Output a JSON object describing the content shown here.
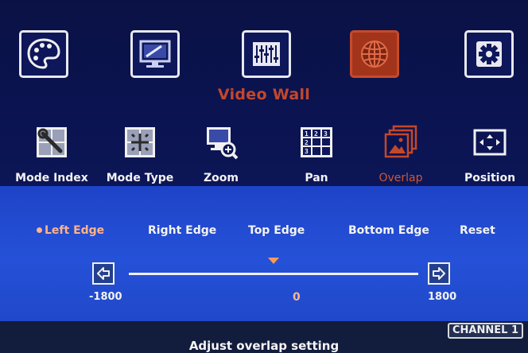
{
  "main_menu": {
    "items": [
      {
        "icon": "palette-icon",
        "active": false
      },
      {
        "icon": "monitor-settings-icon",
        "active": false
      },
      {
        "icon": "equalizer-icon",
        "active": false
      },
      {
        "icon": "globe-icon",
        "active": true
      },
      {
        "icon": "gear-icon",
        "active": false
      }
    ],
    "title": "Video Wall"
  },
  "submenu": {
    "items": [
      {
        "label": "Mode Index",
        "icon": "mode-index-icon"
      },
      {
        "label": "Mode Type",
        "icon": "mode-type-icon"
      },
      {
        "label": "Zoom",
        "icon": "zoom-icon"
      },
      {
        "label": "Pan",
        "icon": "pan-grid-icon"
      },
      {
        "label": "Overlap",
        "icon": "overlap-icon",
        "active": true
      },
      {
        "label": "Position",
        "icon": "position-icon"
      }
    ]
  },
  "options": {
    "items": [
      {
        "label": "Left Edge",
        "selected": true
      },
      {
        "label": "Right Edge"
      },
      {
        "label": "Top Edge"
      },
      {
        "label": "Bottom Edge"
      },
      {
        "label": "Reset"
      }
    ]
  },
  "slider": {
    "min_label": "-1800",
    "max_label": "1800",
    "value_label": "0",
    "min": -1800,
    "max": 1800,
    "value": 0
  },
  "footer": {
    "channel": "CHANNEL 1",
    "hint": "Adjust overlap setting"
  },
  "colors": {
    "active_orange": "#c4472a",
    "selected_peach": "#ffb48a",
    "top_panel": "#0b1350",
    "bottom_panel": "#2551d8"
  }
}
